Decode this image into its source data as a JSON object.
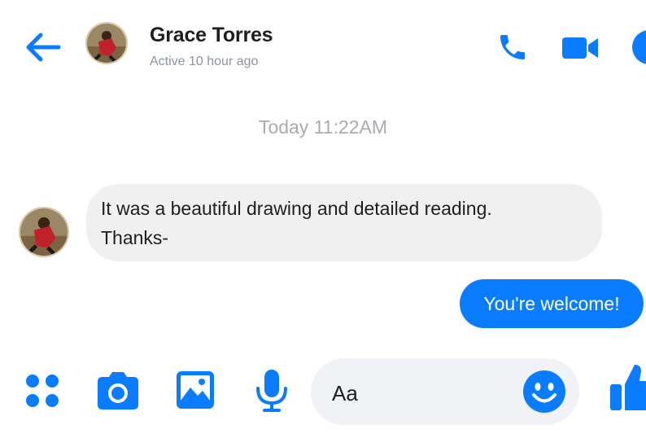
{
  "header": {
    "contact_name": "Grace Torres",
    "status": "Active 10 hour ago",
    "icons": [
      "back-arrow-icon",
      "phone-icon",
      "video-camera-icon",
      "info-icon"
    ]
  },
  "conversation": {
    "timestamp": "Today 11:22AM",
    "messages": [
      {
        "sender": "Grace Torres",
        "direction": "incoming",
        "lines": [
          "It was a beautiful drawing and detailed reading.",
          "Thanks-"
        ]
      },
      {
        "sender": "me",
        "direction": "outgoing",
        "text": "You're welcome!"
      }
    ]
  },
  "composer": {
    "placeholder": "Aa",
    "icons": [
      "apps-icon",
      "camera-icon",
      "image-icon",
      "microphone-icon",
      "emoji-icon",
      "thumbs-up-icon"
    ]
  },
  "theme": {
    "accent": "#0a7cff",
    "bubble_in": "#f0f0f0",
    "composer_bg": "#f0f2f5"
  }
}
